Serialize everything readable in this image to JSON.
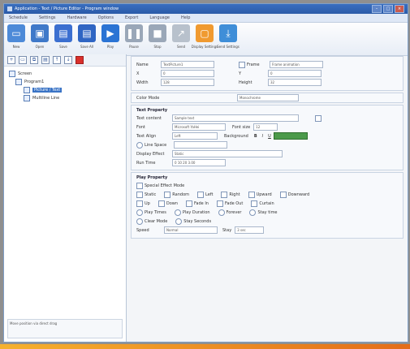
{
  "window": {
    "title": "Application - Text / Picture Editor - Program window"
  },
  "menu": {
    "items": [
      "Schedule",
      "Settings",
      "Hardware",
      "Options",
      "Export",
      "Language",
      "Help"
    ]
  },
  "toolbar": {
    "buttons": [
      {
        "label": "New",
        "color": "#4d8ad8",
        "glyph": "▭"
      },
      {
        "label": "Open",
        "color": "#3f79c9",
        "glyph": "▣"
      },
      {
        "label": "Save",
        "color": "#3b6fd0",
        "glyph": "▤"
      },
      {
        "label": "Save All",
        "color": "#2f65c3",
        "glyph": "▤"
      },
      {
        "label": "Play",
        "color": "#2b74d4",
        "glyph": "▶"
      },
      {
        "label": "Pause",
        "color": "#9aa7b8",
        "glyph": "❚❚"
      },
      {
        "label": "Stop",
        "color": "#9aa7b8",
        "glyph": "■"
      },
      {
        "label": "Send",
        "color": "#b8c1cc",
        "glyph": "↗"
      },
      {
        "label": "Display Settings",
        "color": "#f09a30",
        "glyph": "▢"
      },
      {
        "label": "Send Settings",
        "color": "#3f8ed8",
        "glyph": "⤓"
      }
    ]
  },
  "tree": {
    "root": "Screen",
    "program": "Program1",
    "items": [
      "Picture / Text",
      "Multiline Line"
    ],
    "selected_index": 0
  },
  "sidebar": {
    "footer": "Move position via direct drag"
  },
  "props": {
    "name_label": "Name",
    "name_value": "TextPicture1",
    "x_label": "X",
    "x_value": "0",
    "y_label": "Y",
    "y_value": "0",
    "w_label": "Width",
    "w_value": "128",
    "h_label": "Height",
    "h_value": "32",
    "frame_label": "Frame",
    "frame_value": "Frame animation"
  },
  "color_label": "Color Mode",
  "color_value": "Monochrome",
  "text_section": {
    "title": "Text Property",
    "content_label": "Text content",
    "content_value": "Sample text",
    "font_label": "Font",
    "font_value": "Microsoft YaHei",
    "size_label": "Font size",
    "size_value": "12",
    "align_label": "Text Align",
    "align_value": "Left",
    "bgcolor_label": "Background",
    "line_label": "Line Space",
    "anim_label": "Display Effect",
    "anim_value": "Static",
    "time_label": "Run Time",
    "time_value": "0  10  20  3.00"
  },
  "play_section": {
    "title": "Play Property",
    "subtitle": "Special Effect Mode",
    "row1": [
      "Static",
      "Random",
      "Left",
      "Right",
      "Upward",
      "Downward"
    ],
    "row2": [
      "Up",
      "Down",
      "Fade In",
      "Fade Out",
      "Curtain"
    ],
    "row3": [
      "Play Times",
      "Play Duration",
      "Forever",
      "Stay time"
    ],
    "row4": [
      "Clear Mode",
      "Stay Seconds"
    ],
    "speed_label": "Speed",
    "speed_value": "Normal",
    "stay_label": "Stay",
    "stay_value": "3 sec"
  }
}
